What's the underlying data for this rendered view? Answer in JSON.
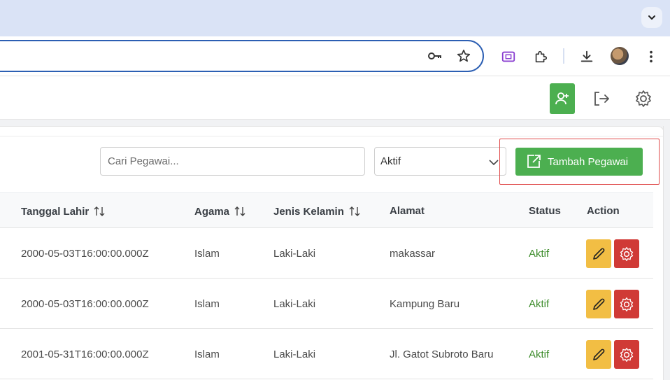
{
  "browser": {
    "tab_menu_icon": "chevron-down-icon",
    "omnibox_icons": [
      "key-icon",
      "star-icon"
    ],
    "toolbar_icons": [
      "screencast-icon",
      "extension-icon",
      "download-icon",
      "avatar",
      "more-vert-icon"
    ]
  },
  "appbar": {
    "icons": [
      "add-user-icon",
      "logout-icon",
      "gear-icon"
    ],
    "accent": "#4caf50"
  },
  "filters": {
    "search_placeholder": "Cari Pegawai...",
    "status_value": "Aktif",
    "add_button_label": "Tambah Pegawai"
  },
  "table": {
    "headers": {
      "tanggal_lahir": "Tanggal Lahir",
      "agama": "Agama",
      "jenis_kelamin": "Jenis Kelamin",
      "alamat": "Alamat",
      "status": "Status",
      "action": "Action"
    },
    "rows": [
      {
        "tanggal_lahir": "2000-05-03T16:00:00.000Z",
        "agama": "Islam",
        "jenis_kelamin": "Laki-Laki",
        "alamat": "makassar",
        "status": "Aktif"
      },
      {
        "tanggal_lahir": "2000-05-03T16:00:00.000Z",
        "agama": "Islam",
        "jenis_kelamin": "Laki-Laki",
        "alamat": "Kampung Baru",
        "status": "Aktif"
      },
      {
        "tanggal_lahir": "2001-05-31T16:00:00.000Z",
        "agama": "Islam",
        "jenis_kelamin": "Laki-Laki",
        "alamat": "Jl. Gatot Subroto Baru",
        "status": "Aktif"
      }
    ],
    "status_color": "#3d8c2b",
    "edit_color": "#f2be44",
    "settings_color": "#d03a36"
  }
}
